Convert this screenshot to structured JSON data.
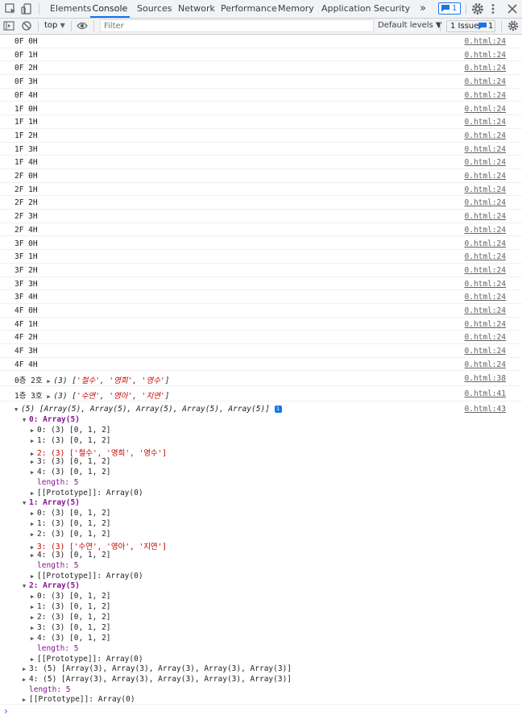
{
  "tabs": [
    "Elements",
    "Console",
    "Sources",
    "Network",
    "Performance",
    "Memory",
    "Application",
    "Security"
  ],
  "more_tabs": "»",
  "msg_badge_count": "1",
  "toolbar": {
    "context": "top",
    "filter_placeholder": "Filter",
    "levels": "Default levels ▼",
    "issues": "1 Issue:",
    "issues_count": "1"
  },
  "log_rows": [
    {
      "text": "0F 0H",
      "src": "0.html:24"
    },
    {
      "text": "0F 1H",
      "src": "0.html:24"
    },
    {
      "text": "0F 2H",
      "src": "0.html:24"
    },
    {
      "text": "0F 3H",
      "src": "0.html:24"
    },
    {
      "text": "0F 4H",
      "src": "0.html:24"
    },
    {
      "text": "1F 0H",
      "src": "0.html:24"
    },
    {
      "text": "1F 1H",
      "src": "0.html:24"
    },
    {
      "text": "1F 2H",
      "src": "0.html:24"
    },
    {
      "text": "1F 3H",
      "src": "0.html:24"
    },
    {
      "text": "1F 4H",
      "src": "0.html:24"
    },
    {
      "text": "2F 0H",
      "src": "0.html:24"
    },
    {
      "text": "2F 1H",
      "src": "0.html:24"
    },
    {
      "text": "2F 2H",
      "src": "0.html:24"
    },
    {
      "text": "2F 3H",
      "src": "0.html:24"
    },
    {
      "text": "2F 4H",
      "src": "0.html:24"
    },
    {
      "text": "3F 0H",
      "src": "0.html:24"
    },
    {
      "text": "3F 1H",
      "src": "0.html:24"
    },
    {
      "text": "3F 2H",
      "src": "0.html:24"
    },
    {
      "text": "3F 3H",
      "src": "0.html:24"
    },
    {
      "text": "3F 4H",
      "src": "0.html:24"
    },
    {
      "text": "4F 0H",
      "src": "0.html:24"
    },
    {
      "text": "4F 1H",
      "src": "0.html:24"
    },
    {
      "text": "4F 2H",
      "src": "0.html:24"
    },
    {
      "text": "4F 3H",
      "src": "0.html:24"
    },
    {
      "text": "4F 4H",
      "src": "0.html:24"
    }
  ],
  "array_rows": [
    {
      "prefix": "0층 2호",
      "len": "(3)",
      "items": [
        "'철수'",
        "'영희'",
        "'영수'"
      ],
      "src": "0.html:38"
    },
    {
      "prefix": "1층 3호",
      "len": "(3)",
      "items": [
        "'수연'",
        "'영아'",
        "'지연'"
      ],
      "src": "0.html:41"
    }
  ],
  "tree": {
    "summary": "(5) [Array(5), Array(5), Array(5), Array(5), Array(5)]",
    "info": "i",
    "src": "0.html:43",
    "l0": "0: Array(5)",
    "l0_items": [
      "0: (3) [0, 1, 2]",
      "1: (3) [0, 1, 2]",
      "2: (3) ['철수', '영희', '영수']",
      "3: (3) [0, 1, 2]",
      "4: (3) [0, 1, 2]"
    ],
    "l1": "1: Array(5)",
    "l1_items": [
      "0: (3) [0, 1, 2]",
      "1: (3) [0, 1, 2]",
      "2: (3) [0, 1, 2]",
      "3: (3) ['수연', '영아', '지연']",
      "4: (3) [0, 1, 2]"
    ],
    "l2": "2: Array(5)",
    "l2_items": [
      "0: (3) [0, 1, 2]",
      "1: (3) [0, 1, 2]",
      "2: (3) [0, 1, 2]",
      "3: (3) [0, 1, 2]",
      "4: (3) [0, 1, 2]"
    ],
    "length": "length: 5",
    "proto": "[[Prototype]]: Array(0)",
    "l3": "3: (5) [Array(3), Array(3), Array(3), Array(3), Array(3)]",
    "l4": "4: (5) [Array(3), Array(3), Array(3), Array(3), Array(3)]"
  },
  "prompt": "›"
}
